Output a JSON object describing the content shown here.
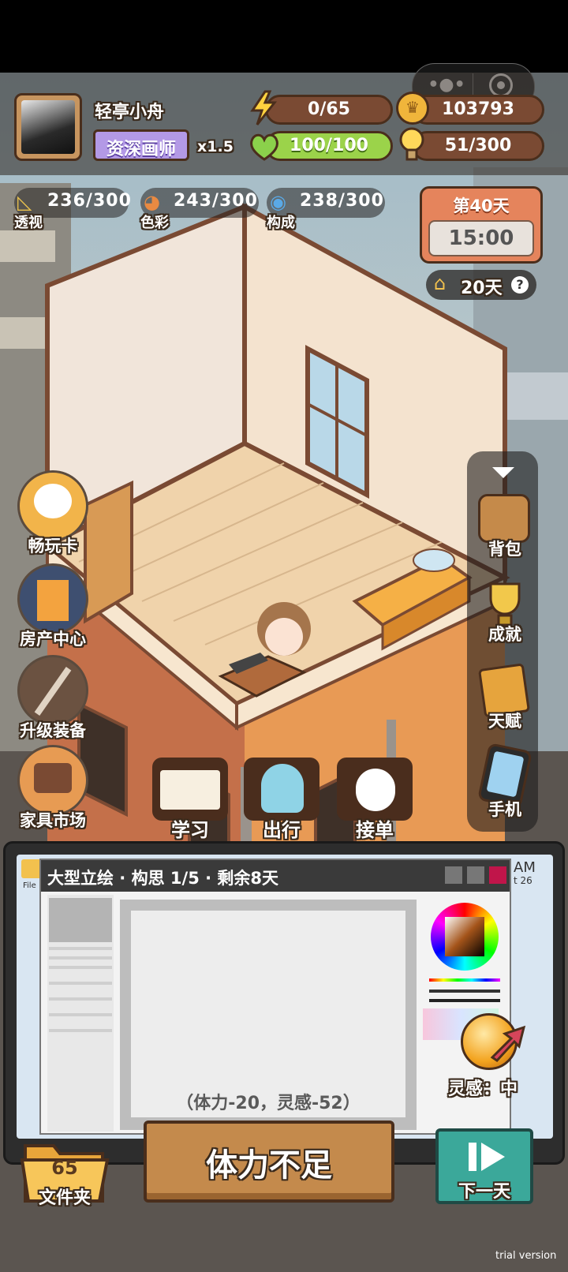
{
  "wechat_capsule": {
    "more_icon": "more-dots-icon",
    "close_icon": "target-circle-icon"
  },
  "player": {
    "name": "轻亭小舟",
    "title": "资深画师",
    "multiplier": "x1.5",
    "avatar_icon": "avatar-portrait"
  },
  "resources": {
    "energy": {
      "icon": "lightning-icon",
      "text": "0/65",
      "value": 0,
      "max": 65
    },
    "coins": {
      "icon": "crown-coin-icon",
      "text": "103793"
    },
    "health": {
      "icon": "heart-icon",
      "text": "100/100",
      "value": 100,
      "max": 100
    },
    "inspiration": {
      "icon": "lightbulb-icon",
      "text": "51/300",
      "value": 51,
      "max": 300
    }
  },
  "skills": [
    {
      "label": "透视",
      "value": "236/300",
      "icon": "ruler-icon"
    },
    {
      "label": "色彩",
      "value": "243/300",
      "icon": "palette-icon"
    },
    {
      "label": "构成",
      "value": "238/300",
      "icon": "camera-icon"
    }
  ],
  "calendar": {
    "day_label": "第40天",
    "time": "15:00"
  },
  "rent": {
    "text": "20天",
    "icon": "house-icon",
    "help_icon": "question-icon"
  },
  "left_menu": [
    {
      "label": "畅玩卡",
      "icon": "dog-card-icon"
    },
    {
      "label": "房产中心",
      "icon": "building-icon"
    },
    {
      "label": "升级装备",
      "icon": "brush-tools-icon"
    },
    {
      "label": "家具市场",
      "icon": "furniture-icon"
    }
  ],
  "right_menu": [
    {
      "label": "背包",
      "icon": "backpack-icon"
    },
    {
      "label": "成就",
      "icon": "trophy-icon"
    },
    {
      "label": "天赋",
      "icon": "talent-book-icon"
    },
    {
      "label": "手机",
      "icon": "phone-icon"
    }
  ],
  "collapse_icon": "triangle-down-icon",
  "actions": [
    {
      "label": "学习",
      "icon": "book-icon"
    },
    {
      "label": "出行",
      "icon": "ghost-icon"
    },
    {
      "label": "接单",
      "icon": "rabbit-icon"
    }
  ],
  "task": {
    "title": "大型立绘 · 构思 1/5 · 剩余8天",
    "cost": "（体力-20，灵感-52）",
    "inspiration_label": "灵感：中",
    "file_label": "File",
    "corner_text_1": "AM",
    "corner_text_2": "t 26"
  },
  "folder": {
    "count": "65",
    "label": "文件夹"
  },
  "main_button": "体力不足",
  "next_day": {
    "label": "下一天",
    "icon": "play-next-icon"
  },
  "watermark": "trial version",
  "colors": {
    "energy_bar": "#7a4a33",
    "health_bar": "#9bd34a",
    "title_badge": "#b399e6",
    "calendar_red": "#e5845c",
    "main_button": "#c48a4c",
    "next_button": "#3ba89a"
  }
}
